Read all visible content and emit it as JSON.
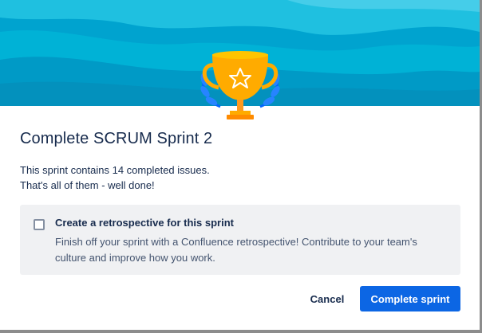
{
  "dialog": {
    "title": "Complete SCRUM Sprint 2",
    "summary_line1": "This sprint contains 14 completed issues.",
    "summary_line2": "That's all of them - well done!",
    "illustration": "trophy-icon"
  },
  "retrospective": {
    "checked": false,
    "title": "Create a retrospective for this sprint",
    "body_line1": "Finish off your sprint with a Confluence retrospective! Contribute to your team's",
    "body_line2": "culture and improve how you work."
  },
  "actions": {
    "cancel_label": "Cancel",
    "complete_label": "Complete sprint"
  },
  "colors": {
    "banner_primary": "#00b8d9",
    "banner_light": "#79e2f2",
    "trophy_gold": "#ffab00",
    "laurel_blue": "#0065ff",
    "primary_button": "#0c66e4",
    "text": "#172b4d"
  }
}
